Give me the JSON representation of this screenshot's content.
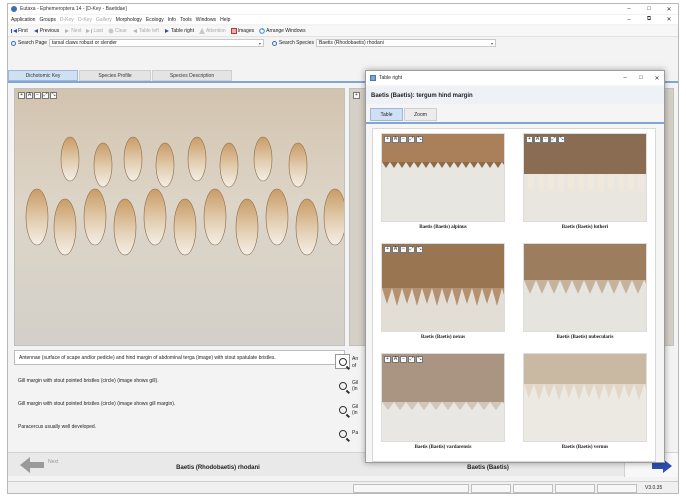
{
  "window": {
    "title": "Eutaxa - Ephemeroptera 14 - [D-Key - Baetidae]",
    "controls": [
      "–",
      "□",
      "✕"
    ],
    "inner_controls": [
      "–",
      "⧉",
      "✕"
    ]
  },
  "menu": [
    {
      "label": "Application",
      "enabled": true
    },
    {
      "label": "Groups",
      "enabled": true
    },
    {
      "label": "D-Key",
      "enabled": false
    },
    {
      "label": "O-Key",
      "enabled": false
    },
    {
      "label": "Gallery",
      "enabled": false
    },
    {
      "label": "Morphology",
      "enabled": true
    },
    {
      "label": "Ecology",
      "enabled": true
    },
    {
      "label": "Info",
      "enabled": true
    },
    {
      "label": "Tools",
      "enabled": true
    },
    {
      "label": "Windows",
      "enabled": true
    },
    {
      "label": "Help",
      "enabled": true
    }
  ],
  "toolbar": [
    {
      "label": "First",
      "enabled": true,
      "icon": "first-icon"
    },
    {
      "label": "Previous",
      "enabled": true,
      "icon": "previous-icon"
    },
    {
      "label": "Next",
      "enabled": false,
      "icon": "next-icon"
    },
    {
      "label": "Last",
      "enabled": false,
      "icon": "last-icon"
    },
    {
      "label": "Clear",
      "enabled": false,
      "icon": "clear-icon"
    },
    {
      "label": "Table left",
      "enabled": false,
      "icon": "table-left-icon"
    },
    {
      "label": "Table right",
      "enabled": true,
      "icon": "table-right-icon"
    },
    {
      "label": "Attention",
      "enabled": false,
      "icon": "attention-icon"
    },
    {
      "label": "Images",
      "enabled": true,
      "icon": "images-icon"
    },
    {
      "label": "Arrange Windows",
      "enabled": true,
      "icon": "arrange-icon"
    }
  ],
  "search": {
    "page_label": "Search Page",
    "page_value": "tarsal claws robust or slender",
    "species_label": "Search Species",
    "species_value": "Baetis (Rhodobaetis) rhodani"
  },
  "tabs": [
    "Dichotomic Key",
    "Species Profile",
    "Species Description"
  ],
  "zoom_buttons": [
    "+",
    "A",
    "−",
    "⤢",
    "⤡"
  ],
  "key_rows": [
    {
      "text": "Antennae (surface of scape and/or pedicle) and hind margin of abdominal terga (image) with stout spatulate bristles.",
      "right": "An",
      "right2": "of"
    },
    {
      "text": "Gill margin with stout pointed bristles (circle) (image shows gill).",
      "right": "Gil",
      "right2": "(in"
    },
    {
      "text": "Gill margin with stout pointed bristles (circle) (image shows gill margin).",
      "right": "Gil",
      "right2": "(in"
    },
    {
      "text": "Paracercus usually well developed.",
      "right": "Pa",
      "right2": ""
    }
  ],
  "navigation": {
    "next_label": "Next",
    "left_result": "Baetis (Rhodobaetis) rhodani",
    "right_result": "Baetis (Baetis)"
  },
  "status": {
    "version": "V3.0.35"
  },
  "float_window": {
    "title": "Table right",
    "heading": "Baetis (Baetis): tergum hind margin",
    "tabs": [
      "Table",
      "Zoom"
    ],
    "images": [
      {
        "caption": "Baetis (Baetis) alpinus"
      },
      {
        "caption": "Baetis (Baetis) lutheri"
      },
      {
        "caption": "Baetis (Baetis) nexus"
      },
      {
        "caption": "Baetis (Baetis) nubecularis"
      },
      {
        "caption": "Baetis (Baetis) vardarensis"
      },
      {
        "caption": "Baetis (Baetis) vernus"
      }
    ]
  },
  "colors": {
    "accent": "#7ea6d8",
    "tab_active": "#cfe0f3",
    "link_blue": "#1f3ea5",
    "nav_arrow": "#2a4fb0"
  }
}
